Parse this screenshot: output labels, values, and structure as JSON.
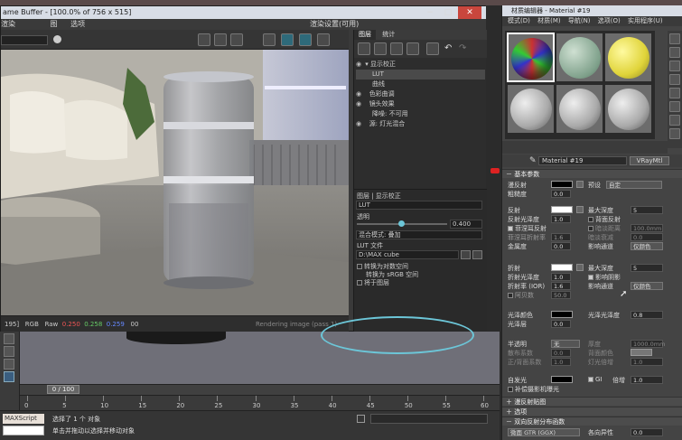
{
  "frame_buffer": {
    "title": "ame Buffer - [100.0% of 756 x 515]",
    "menu": [
      "渲染",
      "图",
      "选项"
    ],
    "render_preset_label": "渲染设置(可用)",
    "status": {
      "left_value": "195]",
      "mode": "RGB",
      "rgb_label": "Raw",
      "r": "0.250",
      "g": "0.258",
      "b": "0.259",
      "info": "00",
      "progress_text": "Rendering image (pass 1)"
    }
  },
  "layers_panel": {
    "tabs": [
      "图层",
      "统计"
    ],
    "rows": [
      "显示校正",
      "LUT",
      "曲线",
      "色彩曲调",
      "镜头效果",
      "降噪: 不可用",
      "源: 灯光混合"
    ],
    "selected_row": 1,
    "properties": {
      "title": "图层 | 显示校正",
      "lut_label": "LUT",
      "opacity_label": "透明",
      "opacity_value": "0.400",
      "blend_label": "混合模式: 叠加",
      "lut_file_label": "LUT 文件",
      "lut_file_value": "D:\\MAX cube",
      "options": [
        "转换为对数空间",
        "转换为 sRGB 空间",
        "将于图层"
      ]
    }
  },
  "viewport": {
    "timeline_label": "0 / 100",
    "ruler_ticks": [
      "0",
      "5",
      "10",
      "15",
      "20",
      "25",
      "30",
      "35",
      "40",
      "45",
      "50",
      "55",
      "60"
    ]
  },
  "status_bar": {
    "maxscript_label": "MAXScript 迷",
    "line1": "选择了 1 个 对象",
    "line2": "单击并拖动以选择并移动对象"
  },
  "material_editor": {
    "title": "材质编辑器 - Material #19",
    "menu": [
      "模式(D)",
      "材质(M)",
      "导航(N)",
      "选项(O)",
      "实用程序(U)"
    ],
    "material_name": "Material #19",
    "material_type": "VRayMtl",
    "rollouts": {
      "basic": "基本参数",
      "bump": "漫反射贴图",
      "brdf": "双向反射分布函数",
      "options": "选项",
      "maps": "贴图"
    },
    "diffuse": {
      "label": "漫反射",
      "roughness_label": "粗糙度",
      "roughness": "0.0",
      "preset_label": "预设",
      "preset_value": "自定"
    },
    "reflect": {
      "label": "反射",
      "gloss_label": "反射光泽度",
      "gloss": "1.0",
      "fresnel_label": "菲涅耳反射",
      "fresnel_ior_label": "菲涅耳折射率",
      "fresnel_ior": "1.6",
      "max_depth_label": "最大深度",
      "max_depth": "5",
      "backside_label": "背面反射",
      "dim_distance_label": "暗淡距离",
      "dim_falloff_label": "暗淡衰减",
      "dim_falloff": "0.0",
      "affect_channels_label": "影响通道",
      "affect_channels": "仅颜色",
      "dim_value": "100.0mm",
      "metalness_label": "金属度",
      "metalness": "0.0"
    },
    "refract": {
      "label": "折射",
      "gloss_label": "折射光泽度",
      "gloss": "1.0",
      "ior_label": "折射率 (IOR)",
      "ior": "1.6",
      "abbe_label": "阿贝数",
      "abbe": "50.0",
      "max_depth_label": "最大深度",
      "max_depth": "5",
      "affect_shadows_label": "影响阴影",
      "affect_channels_label": "影响通道",
      "affect_channels": "仅颜色"
    },
    "sheen": {
      "label": "光泽颜色",
      "gloss_label": "光泽光泽度",
      "gloss": "0.8",
      "layer_label": "光泽层",
      "layer": "0.0"
    },
    "translucency": {
      "label": "半透明",
      "mode": "无",
      "scatter_label": "散布系数",
      "scatter": "0.0",
      "fwd_label": "正/背面系数",
      "fwd": "1.0",
      "thickness_label": "厚度",
      "thickness": "1000.0mm",
      "back_color_label": "背面颜色",
      "light_mult_label": "灯光倍增",
      "light_mult": "1.0"
    },
    "self_illum": {
      "label": "自发光",
      "gi_label": "GI",
      "mult_label": "倍增",
      "mult": "1.0",
      "compensate_label": "补偿摄影机曝光"
    },
    "brdf_type": "微面 GTR (GGX)",
    "aniso_label": "各向异性",
    "aniso_value": "0.0"
  }
}
